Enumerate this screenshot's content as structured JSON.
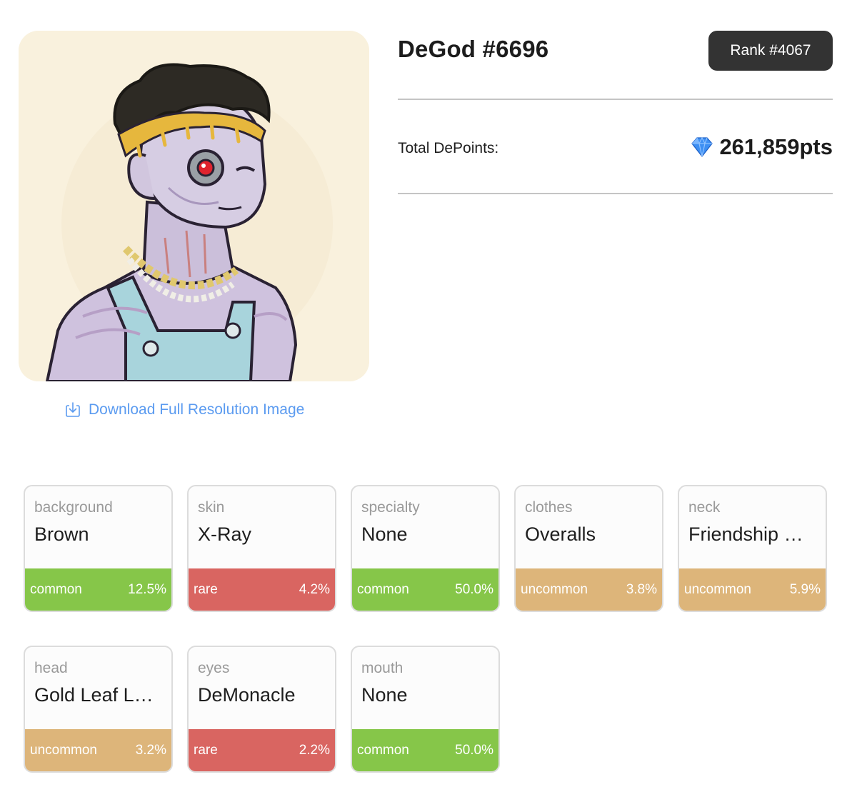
{
  "nft": {
    "title": "DeGod #6696",
    "rank": "Rank #4067",
    "points_label": "Total DePoints:",
    "points_value": "261,859pts",
    "points_icon": "diamond-icon",
    "download_label": "Download Full Resolution Image",
    "download_icon": "download-icon"
  },
  "colors": {
    "common": "#86c649",
    "rare": "#d96561",
    "uncommon": "#ddb57a",
    "link": "#5b9bf0",
    "rank_badge": "#333333"
  },
  "attributes": [
    {
      "category": "background",
      "value": "Brown",
      "rarity": "common",
      "percent": "12.5%"
    },
    {
      "category": "skin",
      "value": "X-Ray",
      "rarity": "rare",
      "percent": "4.2%"
    },
    {
      "category": "specialty",
      "value": "None",
      "rarity": "common",
      "percent": "50.0%"
    },
    {
      "category": "clothes",
      "value": "Overalls",
      "rarity": "uncommon",
      "percent": "3.8%"
    },
    {
      "category": "neck",
      "value": "Friendship …",
      "rarity": "uncommon",
      "percent": "5.9%"
    },
    {
      "category": "head",
      "value": "Gold Leaf L…",
      "rarity": "uncommon",
      "percent": "3.2%"
    },
    {
      "category": "eyes",
      "value": "DeMonacle",
      "rarity": "rare",
      "percent": "2.2%"
    },
    {
      "category": "mouth",
      "value": "None",
      "rarity": "common",
      "percent": "50.0%"
    }
  ]
}
